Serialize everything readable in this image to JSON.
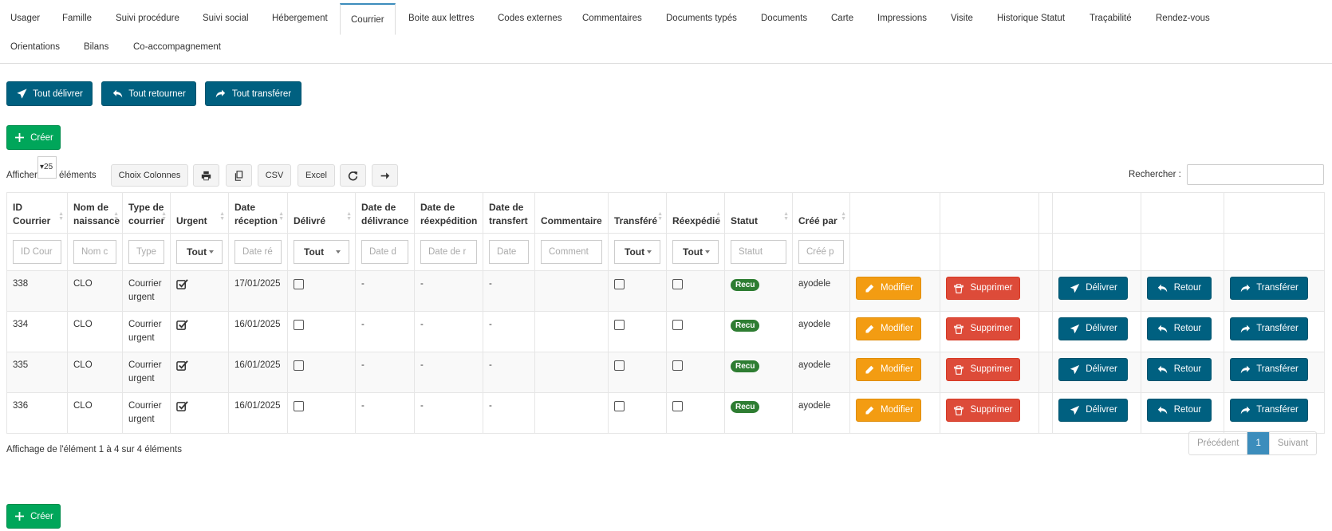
{
  "tabs": [
    {
      "label": "Usager",
      "active": false
    },
    {
      "label": "Famille",
      "active": false
    },
    {
      "label": "Suivi procédure",
      "active": false
    },
    {
      "label": "Suivi social",
      "active": false
    },
    {
      "label": "Hébergement",
      "active": false
    },
    {
      "label": "Courrier",
      "active": true
    },
    {
      "label": "Boite aux lettres",
      "active": false
    },
    {
      "label": "Codes externes",
      "active": false
    },
    {
      "label": "Commentaires",
      "active": false
    },
    {
      "label": "Documents  typés",
      "active": false
    },
    {
      "label": "Documents",
      "active": false
    },
    {
      "label": "Carte",
      "active": false
    },
    {
      "label": "Impressions",
      "active": false
    },
    {
      "label": "Visite",
      "active": false
    },
    {
      "label": "Historique Statut",
      "active": false
    },
    {
      "label": "Traçabilité",
      "active": false
    },
    {
      "label": "Rendez-vous",
      "active": false
    },
    {
      "label": "Orientations",
      "active": false
    },
    {
      "label": "Bilans",
      "active": false
    },
    {
      "label": "Co-accompagnement",
      "active": false
    }
  ],
  "bulk_actions": {
    "deliver_all": "Tout délivrer",
    "return_all": "Tout retourner",
    "transfer_all": "Tout transférer"
  },
  "create_label": "Créer",
  "toolbar": {
    "show_label": "Afficher",
    "page_length": "25",
    "elements_label": "éléments",
    "columns_label": "Choix Colonnes",
    "csv_label": "CSV",
    "excel_label": "Excel",
    "search_label": "Rechercher :"
  },
  "columns": {
    "id": "ID Courrier",
    "birth_name": "Nom de naissance",
    "mail_type": "Type de courrier",
    "urgent": "Urgent",
    "received": "Date réception",
    "delivered": "Délivré",
    "delivery_date": "Date de délivrance",
    "reship_date": "Date de réexpédition",
    "transfer_date": "Date de transfert",
    "comment": "Commentaire",
    "transferred": "Transféré",
    "reshipped": "Réexpédié",
    "status": "Statut",
    "created_by": "Créé par"
  },
  "filters": {
    "id": "ID Cour",
    "birth_name": "Nom c",
    "mail_type": "Type",
    "urgent": "Tout",
    "received": "Date ré",
    "delivered": "Tout",
    "delivery_date": "Date d",
    "reship_date": "Date de r",
    "transfer_date": "Date",
    "comment": "Comment",
    "transferred": "Tout",
    "reshipped": "Tout",
    "status": "Statut",
    "created_by": "Créé p"
  },
  "rows": [
    {
      "id": "338",
      "birth_name": "CLO",
      "mail_type": "Courrier urgent",
      "urgent": true,
      "received": "17/01/2025",
      "delivered": false,
      "delivery_date": "-",
      "reship_date": "-",
      "transfer_date": "-",
      "comment": "",
      "transferred": false,
      "reshipped": false,
      "status": "Recu",
      "created_by": "ayodele"
    },
    {
      "id": "334",
      "birth_name": "CLO",
      "mail_type": "Courrier urgent",
      "urgent": true,
      "received": "16/01/2025",
      "delivered": false,
      "delivery_date": "-",
      "reship_date": "-",
      "transfer_date": "-",
      "comment": "",
      "transferred": false,
      "reshipped": false,
      "status": "Recu",
      "created_by": "ayodele"
    },
    {
      "id": "335",
      "birth_name": "CLO",
      "mail_type": "Courrier urgent",
      "urgent": true,
      "received": "16/01/2025",
      "delivered": false,
      "delivery_date": "-",
      "reship_date": "-",
      "transfer_date": "-",
      "comment": "",
      "transferred": false,
      "reshipped": false,
      "status": "Recu",
      "created_by": "ayodele"
    },
    {
      "id": "336",
      "birth_name": "CLO",
      "mail_type": "Courrier urgent",
      "urgent": true,
      "received": "16/01/2025",
      "delivered": false,
      "delivery_date": "-",
      "reship_date": "-",
      "transfer_date": "-",
      "comment": "",
      "transferred": false,
      "reshipped": false,
      "status": "Recu",
      "created_by": "ayodele"
    }
  ],
  "row_actions": {
    "edit": "Modifier",
    "delete": "Supprimer",
    "deliver": "Délivrer",
    "return": "Retour",
    "transfer": "Transférer"
  },
  "footer": {
    "info": "Affichage de l'élément 1 à 4 sur 4 éléments",
    "prev": "Précédent",
    "page": "1",
    "next": "Suivant"
  },
  "colors": {
    "teal": "#006080",
    "green": "#00a65a",
    "orange": "#f39c12",
    "red": "#dd4b39",
    "badge": "#2e7d32",
    "active_tab": "#3c8dbc"
  },
  "icons": {
    "deliver": "paper-plane-icon",
    "return": "reply-icon",
    "transfer": "share-icon",
    "create": "plus-icon",
    "edit": "pencil-icon",
    "delete": "trash-icon",
    "print": "print-icon",
    "copy": "copy-icon",
    "refresh": "refresh-icon",
    "next": "arrow-right-icon"
  }
}
